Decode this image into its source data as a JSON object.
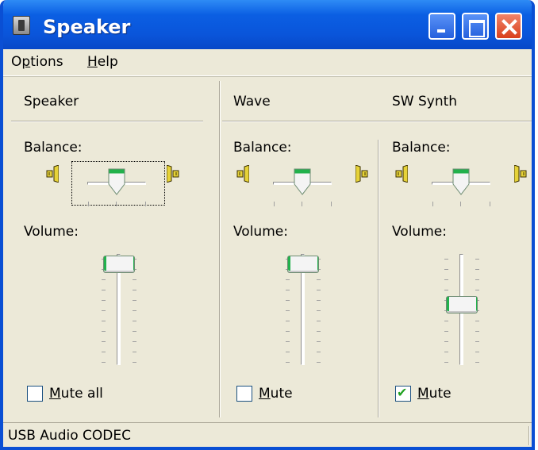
{
  "window": {
    "title": "Speaker"
  },
  "menu": [
    {
      "label": "Options",
      "key": "p"
    },
    {
      "label": "Help",
      "key": "H"
    }
  ],
  "channels": [
    {
      "name": "Speaker",
      "balance_label": "Balance:",
      "volume_label": "Volume:",
      "balance": 0.5,
      "volume": 0.95,
      "mute_label": "Mute all",
      "muted": false
    },
    {
      "name": "Wave",
      "balance_label": "Balance:",
      "volume_label": "Volume:",
      "balance": 0.5,
      "volume": 0.95,
      "mute_label": "Mute",
      "muted": false
    },
    {
      "name": "SW Synth",
      "balance_label": "Balance:",
      "volume_label": "Volume:",
      "balance": 0.5,
      "volume": 0.55,
      "mute_label": "Mute",
      "muted": true
    }
  ],
  "status": {
    "text": "USB Audio CODEC"
  },
  "colors": {
    "titlebar": "#0A55DA",
    "face": "#ECE9D8",
    "thumb_accent": "#22B14C",
    "check": "#21A121"
  },
  "icons": {
    "balance_left": "speaker-left-icon",
    "balance_right": "speaker-right-icon"
  }
}
